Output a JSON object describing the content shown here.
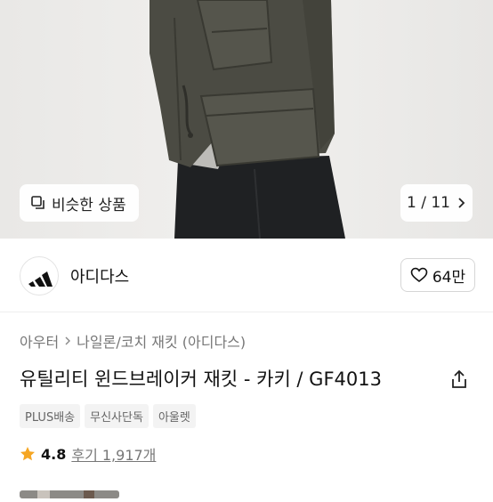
{
  "gallery": {
    "similar_label": "비슷한 상품",
    "counter": "1 / 11"
  },
  "brand": {
    "name": "아디다스",
    "likes": "64만"
  },
  "breadcrumb": {
    "items": [
      "아우터",
      "나일론/코치 재킷 (아디다스)"
    ]
  },
  "product": {
    "title": "유틸리티 윈드브레이커 재킷 - 카키 / GF4013",
    "tags": [
      "PLUS배송",
      "무신사단독",
      "아울렛"
    ],
    "rating": "4.8",
    "reviews": "후기 1,917개"
  },
  "colors": {
    "star": "#F5A623",
    "jacket": "#4a4a42",
    "tag_bg": "#f3f3f3"
  }
}
